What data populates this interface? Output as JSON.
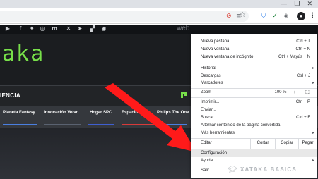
{
  "window_controls": {
    "minimize": "—",
    "maximize": "❐",
    "close": "✕"
  },
  "page": {
    "web_text": "web",
    "logo_text": "aka",
    "section_title": "IENCIA",
    "nav_items": [
      {
        "label": "Planeta Fantasy",
        "accent": "#4a7fe0"
      },
      {
        "label": "Innovación Volvo",
        "accent": "#5a6270"
      },
      {
        "label": "Hogar SPC",
        "accent": "#3f5fd0"
      },
      {
        "label": "Espacio",
        "accent": "#d83a3a"
      },
      {
        "label": "Philips The One",
        "accent": "#4a7fe0"
      }
    ],
    "social_icons": [
      "youtube-icon",
      "facebook-icon",
      "twitter-icon",
      "instagram-icon",
      "m-icon",
      "x-icon",
      "telegram-icon",
      "flipboard-icon",
      "rss-icon"
    ],
    "logo_color": "#78e04a"
  },
  "menu": {
    "new_tab": {
      "label": "Nueva pestaña",
      "shortcut": "Ctrl + T"
    },
    "new_window": {
      "label": "Nueva ventana",
      "shortcut": "Ctrl + N"
    },
    "incognito": {
      "label": "Nueva ventana de incógnito",
      "shortcut": "Ctrl + Mayús + N"
    },
    "history": {
      "label": "Historial"
    },
    "downloads": {
      "label": "Descargas",
      "shortcut": "Ctrl + J"
    },
    "bookmarks": {
      "label": "Marcadores"
    },
    "zoom": {
      "label": "Zoom",
      "minus": "−",
      "value": "100 %",
      "plus": "+",
      "fullscreen": "⛶"
    },
    "print": {
      "label": "Imprimir...",
      "shortcut": "Ctrl + P"
    },
    "cast": {
      "label": "Enviar..."
    },
    "find": {
      "label": "Buscar...",
      "shortcut": "Ctrl + F"
    },
    "converted_page": {
      "label": "Alternar contenido de la página convertida"
    },
    "more_tools": {
      "label": "Más herramientas"
    },
    "edit": {
      "label": "Editar",
      "cut": "Cortar",
      "copy": "Copiar",
      "paste": "Pegar"
    },
    "settings": {
      "label": "Configuración"
    },
    "help": {
      "label": "Ayuda"
    },
    "exit": {
      "label": "Salir"
    }
  },
  "watermark": {
    "text": "XATAKA BASICS"
  },
  "colors": {
    "arrow": "#ff1a1a",
    "highlight": "#e8e8e8"
  }
}
